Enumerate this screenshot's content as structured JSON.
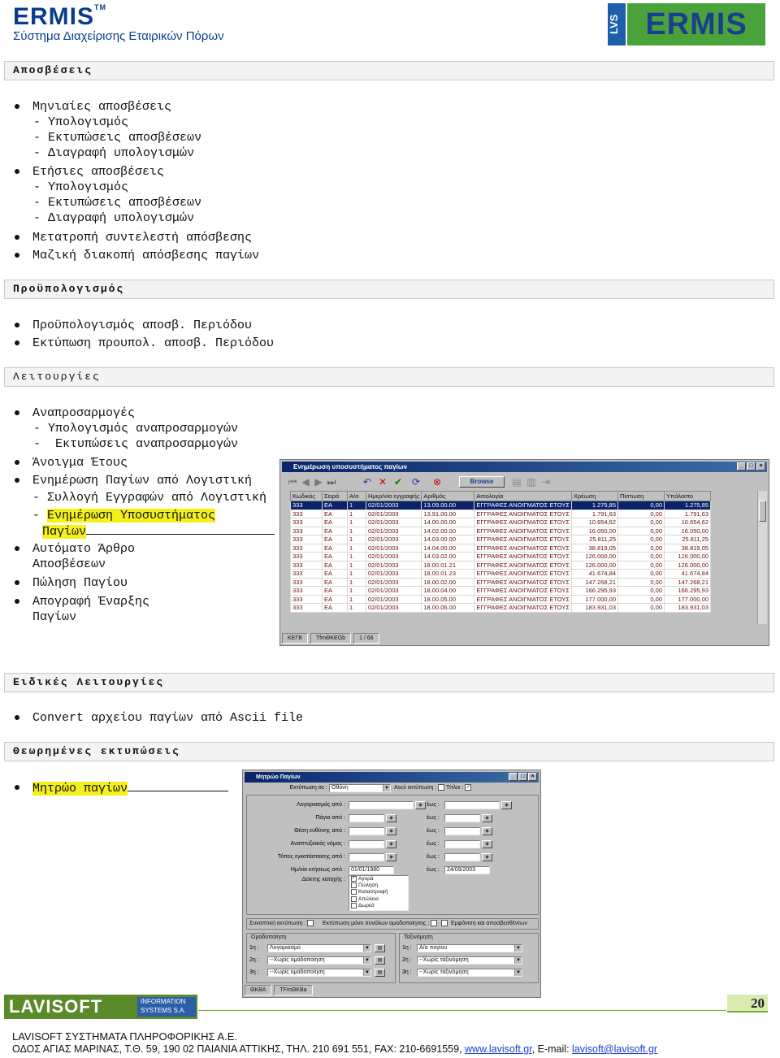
{
  "header": {
    "brand": "ERMIS",
    "brand_tm": "TM",
    "subtitle": "Σύστημα Διαχείρισης Εταιρικών Πόρων",
    "logo_lvs": "LVS",
    "logo_ermis": "ERMIS"
  },
  "sections": {
    "apos": "Αποσβέσεις",
    "budget": "Προϋπολογισμός",
    "functions": "Λειτουργίες",
    "special": "Ειδικές Λειτουργίες",
    "reports": "Θεωρημένες εκτυπώσεις"
  },
  "apos_items": {
    "l1": "Μηνιαίες αποσβέσεις",
    "l2": " - Υπολογισμός",
    "l3": " - Εκτυπώσεις αποσβέσεων",
    "l4": " - Διαγραφή υπολογισμών",
    "l5": "Ετήσιες αποσβέσεις",
    "l6": " - Υπολογισμός",
    "l7": " - Εκτυπώσεις αποσβέσεων",
    "l8": " - Διαγραφή υπολογισμών",
    "l9": "Μετατροπή συντελεστή απόσβεσης",
    "l10": "Μαζική διακοπή απόσβεσης παγίων"
  },
  "budget_items": {
    "l1": "Προϋπολογισμός αποσβ. Περιόδου",
    "l2": "Εκτύπωση προυπολ. αποσβ. Περιόδου"
  },
  "func_items": {
    "l1": "Αναπροσαρμογές",
    "l2": " - Υπολογισμός αναπροσαρμογών",
    "l3": " -  Εκτυπώσεις αναπροσαρμογών",
    "l4": "Άνοιγμα Έτους",
    "l5": "Ενημέρωση Παγίων από Λογιστική",
    "l6": "- Συλλογή Εγγραφών από Λογιστική",
    "l7a": "- ",
    "l7b": "Ενημέρωση Υποσυστήματος",
    "l8": "Παγίων",
    "l9": "Αυτόματο Άρθρο",
    "l10": "Αποσβέσεων",
    "l11": "Πώληση Παγίου",
    "l12": "Απογραφή Έναρξης",
    "l13": "Παγίων"
  },
  "special_items": {
    "l1": "Convert αρχείου παγίων από Ascii file"
  },
  "report_items": {
    "l1": "Μητρώο παγίων"
  },
  "win1": {
    "title": "Ενημέρωση υποσυστήματος παγίων",
    "browse": "Browse",
    "columns": [
      "Κωδικός",
      "Σειρά",
      "Α/α",
      "Ημερ/νία εγγραφής",
      "Αριθμός",
      "Αιτιολογία",
      "Χρέωση",
      "Πίστωση",
      "Υπόλοιπο"
    ],
    "rows": [
      [
        "333",
        "ΕΑ",
        "1",
        "02/01/2003",
        "13.09.00.00",
        "ΕΓΓΡΑΦΕΣ ΑΝΟΙΓΜΑΤΟΣ ΕΤΟΥΣ",
        "1.275,85",
        "0,00",
        "1.275,85"
      ],
      [
        "333",
        "ΕΑ",
        "1",
        "02/01/2003",
        "13.91.00.00",
        "ΕΓΓΡΑΦΕΣ ΑΝΟΙΓΜΑΤΟΣ ΕΤΟΥΣ",
        "1.791,63",
        "0,00",
        "1.791,63"
      ],
      [
        "333",
        "ΕΑ",
        "1",
        "02/01/2003",
        "14.00.00.00",
        "ΕΓΓΡΑΦΕΣ ΑΝΟΙΓΜΑΤΟΣ ΕΤΟΥΣ",
        "10.654,62",
        "0,00",
        "10.654,62"
      ],
      [
        "333",
        "ΕΑ",
        "1",
        "02/01/2003",
        "14.02.00.00",
        "ΕΓΓΡΑΦΕΣ ΑΝΟΙΓΜΑΤΟΣ ΕΤΟΥΣ",
        "16.050,00",
        "0,00",
        "16.050,00"
      ],
      [
        "333",
        "ΕΑ",
        "1",
        "02/01/2003",
        "14.03.00.00",
        "ΕΓΓΡΑΦΕΣ ΑΝΟΙΓΜΑΤΟΣ ΕΤΟΥΣ",
        "25.811,25",
        "0,00",
        "25.811,25"
      ],
      [
        "333",
        "ΕΑ",
        "1",
        "02/01/2003",
        "14.04.00.00",
        "ΕΓΓΡΑΦΕΣ ΑΝΟΙΓΜΑΤΟΣ ΕΤΟΥΣ",
        "38.819,05",
        "0,00",
        "38.819,05"
      ],
      [
        "333",
        "ΕΑ",
        "1",
        "02/01/2003",
        "14.03.02.00",
        "ΕΓΓΡΑΦΕΣ ΑΝΟΙΓΜΑΤΟΣ ΕΤΟΥΣ",
        "126.000,00",
        "0,00",
        "126.000,00"
      ],
      [
        "333",
        "ΕΑ",
        "1",
        "02/01/2003",
        "18.00.01.21",
        "ΕΓΓΡΑΦΕΣ ΑΝΟΙΓΜΑΤΟΣ ΕΤΟΥΣ",
        "126.000,00",
        "0,00",
        "126.000,00"
      ],
      [
        "333",
        "ΕΑ",
        "1",
        "02/01/2003",
        "18.00.01.23",
        "ΕΓΓΡΑΦΕΣ ΑΝΟΙΓΜΑΤΟΣ ΕΤΟΥΣ",
        "41.674,84",
        "0,00",
        "41.674,84"
      ],
      [
        "333",
        "ΕΑ",
        "1",
        "02/01/2003",
        "18.00.02.00",
        "ΕΓΓΡΑΦΕΣ ΑΝΟΙΓΜΑΤΟΣ ΕΤΟΥΣ",
        "147.268,21",
        "0,00",
        "147.268,21"
      ],
      [
        "333",
        "ΕΑ",
        "1",
        "02/01/2003",
        "18.00.04.00",
        "ΕΓΓΡΑΦΕΣ ΑΝΟΙΓΜΑΤΟΣ ΕΤΟΥΣ",
        "166.295,93",
        "0,00",
        "166.295,93"
      ],
      [
        "333",
        "ΕΑ",
        "1",
        "02/01/2003",
        "18.00.05.00",
        "ΕΓΓΡΑΦΕΣ ΑΝΟΙΓΜΑΤΟΣ ΕΤΟΥΣ",
        "177.000,00",
        "0,00",
        "177.000,00"
      ],
      [
        "333",
        "ΕΑ",
        "1",
        "02/01/2003",
        "18.00.06.00",
        "ΕΓΓΡΑΦΕΣ ΑΝΟΙΓΜΑΤΟΣ ΕΤΟΥΣ",
        "183.931,03",
        "0,00",
        "183.931,03"
      ]
    ],
    "status": [
      "ΚΕΓΒ",
      "TfmΘΚΕGb",
      "1 / 66"
    ]
  },
  "win2": {
    "title": "Μητρώο Παγίων",
    "output_label": "Εκτύπωση σε :",
    "output_value": "Οθόνη",
    "ascii_label": "Ascii εκτύπωση :",
    "titles_label": "Τίτλοι :",
    "labels": [
      "Λογαριασμός από :",
      "Πάγιο από :",
      "Θέση ευθύνης από :",
      "Αναπτυξιακός νόμος :",
      "Τόπος εγκατάστασης από :",
      "Ημ/νία κτήσεως από :",
      "Δείκτης κατοχής :"
    ],
    "to_label": "έως :",
    "date_from": "01/01/1980",
    "date_to": "24/09/2003",
    "ownership": [
      "Αγορά",
      "Πώληση",
      "Καταστροφή",
      "Απώλεια",
      "Δωρεά"
    ],
    "options": [
      "Συνοπτική εκτύπωση :",
      "Εκτύπωση μόνο συνόλων ομαδοποίησης :",
      "Εμφάνιση και αποσβεσθέντων"
    ],
    "grouping_title": "Ομαδοποίηση",
    "sorting_title": "Ταξινόμηση",
    "grouping": [
      [
        "1η :",
        "Λογαριασμό"
      ],
      [
        "2η :",
        "--Χωρίς ομαδοποίηση"
      ],
      [
        "3η :",
        "--Χωρίς ομαδοποίηση"
      ]
    ],
    "sorting": [
      [
        "1η :",
        "Α/α παγίου"
      ],
      [
        "2η :",
        "--Χωρίς ταξινόμηση"
      ],
      [
        "3η :",
        "--Χωρίς ταξινόμηση"
      ]
    ],
    "status": [
      "ΘΚΒΑ",
      "TFmΘΚΒa"
    ]
  },
  "footer": {
    "logo": "LAVISOFT",
    "logo_info1": "INFORMATION",
    "logo_info2": "SYSTEMS S.A.",
    "page": "20",
    "line1": "LAVISOFT ΣΥΣΤΗΜΑΤΑ ΠΛΗΡΟΦΟΡΙΚΗΣ Α.Ε.",
    "line2_pre": "ΟΔΟΣ ΑΓΙΑΣ ΜΑΡΙΝΑΣ, Τ.Θ. 59, 190 02 ΠΑΙΑΝΙΑ ΑΤΤΙΚΗΣ, ΤΗΛ. 210 691 551, FAX: 210-6691559, ",
    "web": "www.lavisoft.gr",
    "email_label": ", E-mail: ",
    "email": "lavisoft@lavisoft.gr"
  },
  "colors": {
    "section_bg": "#f3f3f3",
    "highlight": "#f5ef1a",
    "brand_blue": "#0a3c8c",
    "lavisoft_green": "#5a8a2a"
  }
}
